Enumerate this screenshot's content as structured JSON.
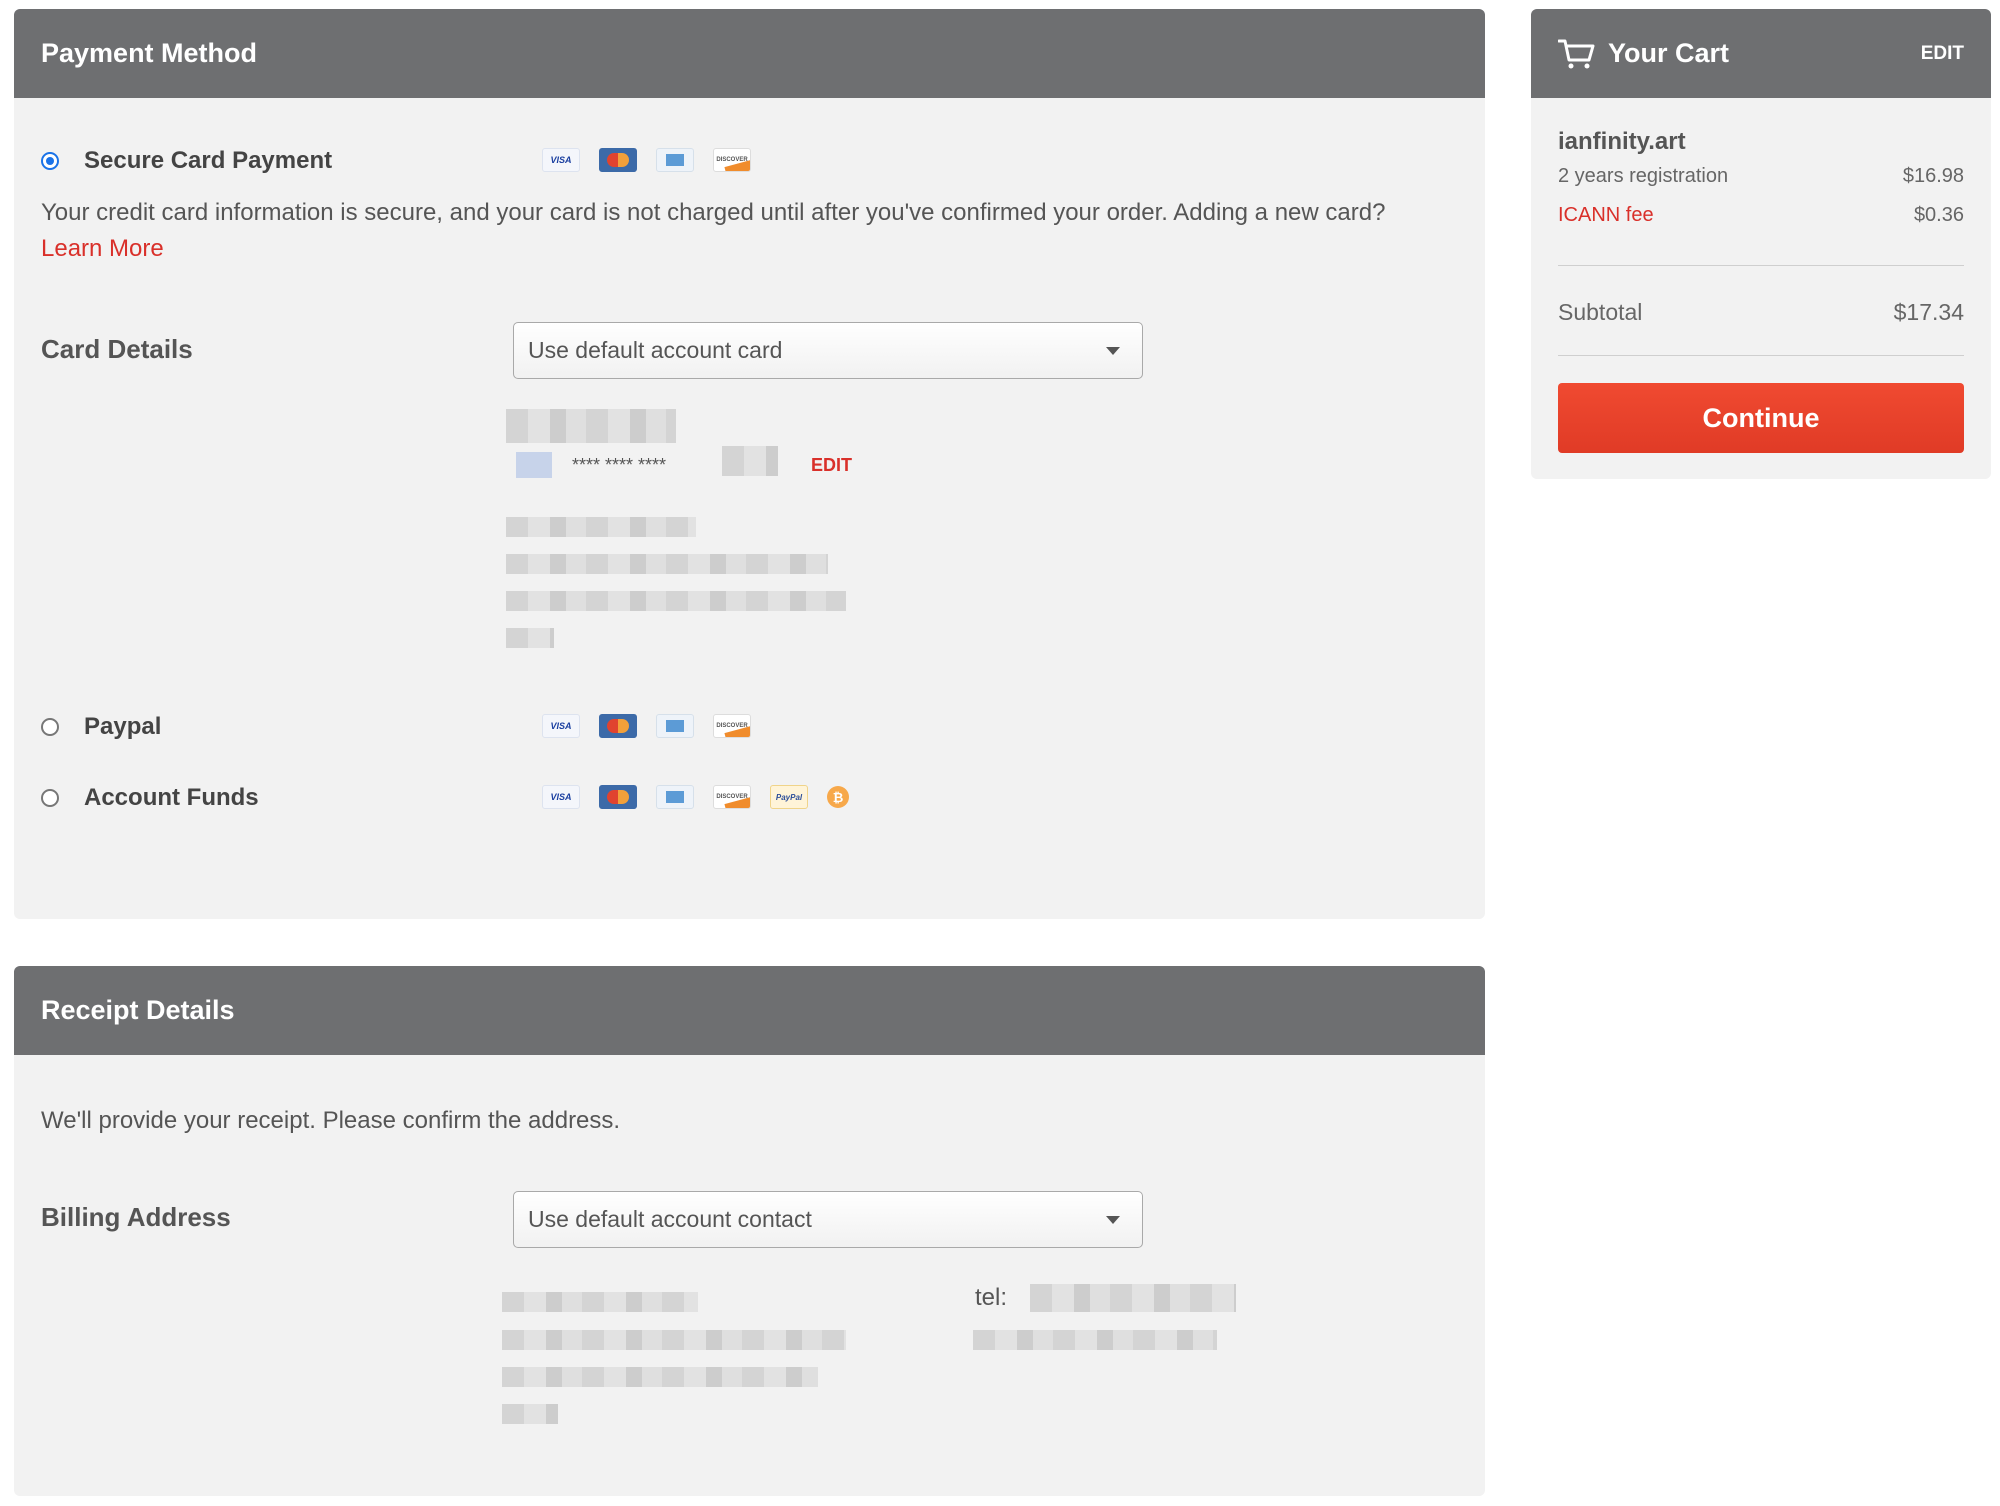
{
  "payment": {
    "title": "Payment Method",
    "options": [
      {
        "label": "Secure Card Payment"
      },
      {
        "label": "Paypal"
      },
      {
        "label": "Account Funds"
      }
    ],
    "secure_note": "Your credit card information is secure, and your card is not charged until after you've confirmed your order. Adding a new card?",
    "learn_more": "Learn More",
    "card_details_label": "Card Details",
    "card_select": "Use default account card",
    "card_masked": "**** **** ****",
    "card_edit": "EDIT",
    "card_logos": {
      "visa": "VISA",
      "discover": "DISCOVER",
      "paypal": "PayPal",
      "bitcoin": "₿"
    }
  },
  "receipt": {
    "title": "Receipt Details",
    "note": "We'll provide your receipt. Please confirm the address.",
    "billing_label": "Billing Address",
    "billing_select": "Use default account contact",
    "tel_label": "tel:"
  },
  "cart": {
    "title": "Your Cart",
    "edit": "EDIT",
    "domain": "ianfinity.art",
    "registration_label": "2 years registration",
    "registration_price": "$16.98",
    "icann_label": "ICANN fee",
    "icann_price": "$0.36",
    "subtotal_label": "Subtotal",
    "subtotal_value": "$17.34",
    "continue": "Continue"
  },
  "colors": {
    "header_bg": "#6e6f71",
    "panel_bg": "#f2f2f2",
    "accent_red": "#d9302a",
    "radio_blue": "#1a73e8",
    "continue_bg": "#e8432c"
  }
}
